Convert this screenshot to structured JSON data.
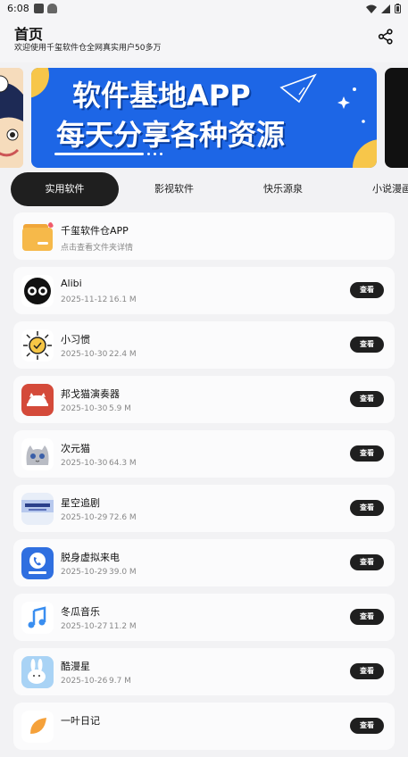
{
  "status": {
    "time": "6:08"
  },
  "header": {
    "title": "首页",
    "subtitle": "欢迎使用千玺软件仓全网真实用户50多万"
  },
  "banner": {
    "line1": "软件基地APP",
    "line2": "每天分享各种资源"
  },
  "tabs": [
    {
      "label": "实用软件",
      "active": true
    },
    {
      "label": "影视软件",
      "active": false
    },
    {
      "label": "快乐源泉",
      "active": false
    },
    {
      "label": "小说漫画",
      "active": false
    }
  ],
  "featured": {
    "name": "千玺软件仓APP",
    "subtitle": "点击查看文件夹详情"
  },
  "view_label": "查看",
  "apps": [
    {
      "name": "Alibi",
      "date": "2025-11-12",
      "size": "16.1 M",
      "icon": "alibi-eyes-icon"
    },
    {
      "name": "小习惯",
      "date": "2025-10-30",
      "size": "22.4 M",
      "icon": "sun-clock-icon"
    },
    {
      "name": "邦戈猫演奏器",
      "date": "2025-10-30",
      "size": "5.9 M",
      "icon": "bongo-cat-icon"
    },
    {
      "name": "次元猫",
      "date": "2025-10-30",
      "size": "64.3 M",
      "icon": "anime-cat-icon"
    },
    {
      "name": "星空追剧",
      "date": "2025-10-29",
      "size": "72.6 M",
      "icon": "starry-drama-icon"
    },
    {
      "name": "脱身虚拟来电",
      "date": "2025-10-29",
      "size": "39.0 M",
      "icon": "phone-call-icon"
    },
    {
      "name": "冬瓜音乐",
      "date": "2025-10-27",
      "size": "11.2 M",
      "icon": "music-note-icon"
    },
    {
      "name": "酷漫星",
      "date": "2025-10-26",
      "size": "9.7 M",
      "icon": "bunny-icon"
    },
    {
      "name": "一叶日记",
      "date": "",
      "size": "",
      "icon": "leaf-icon"
    }
  ]
}
